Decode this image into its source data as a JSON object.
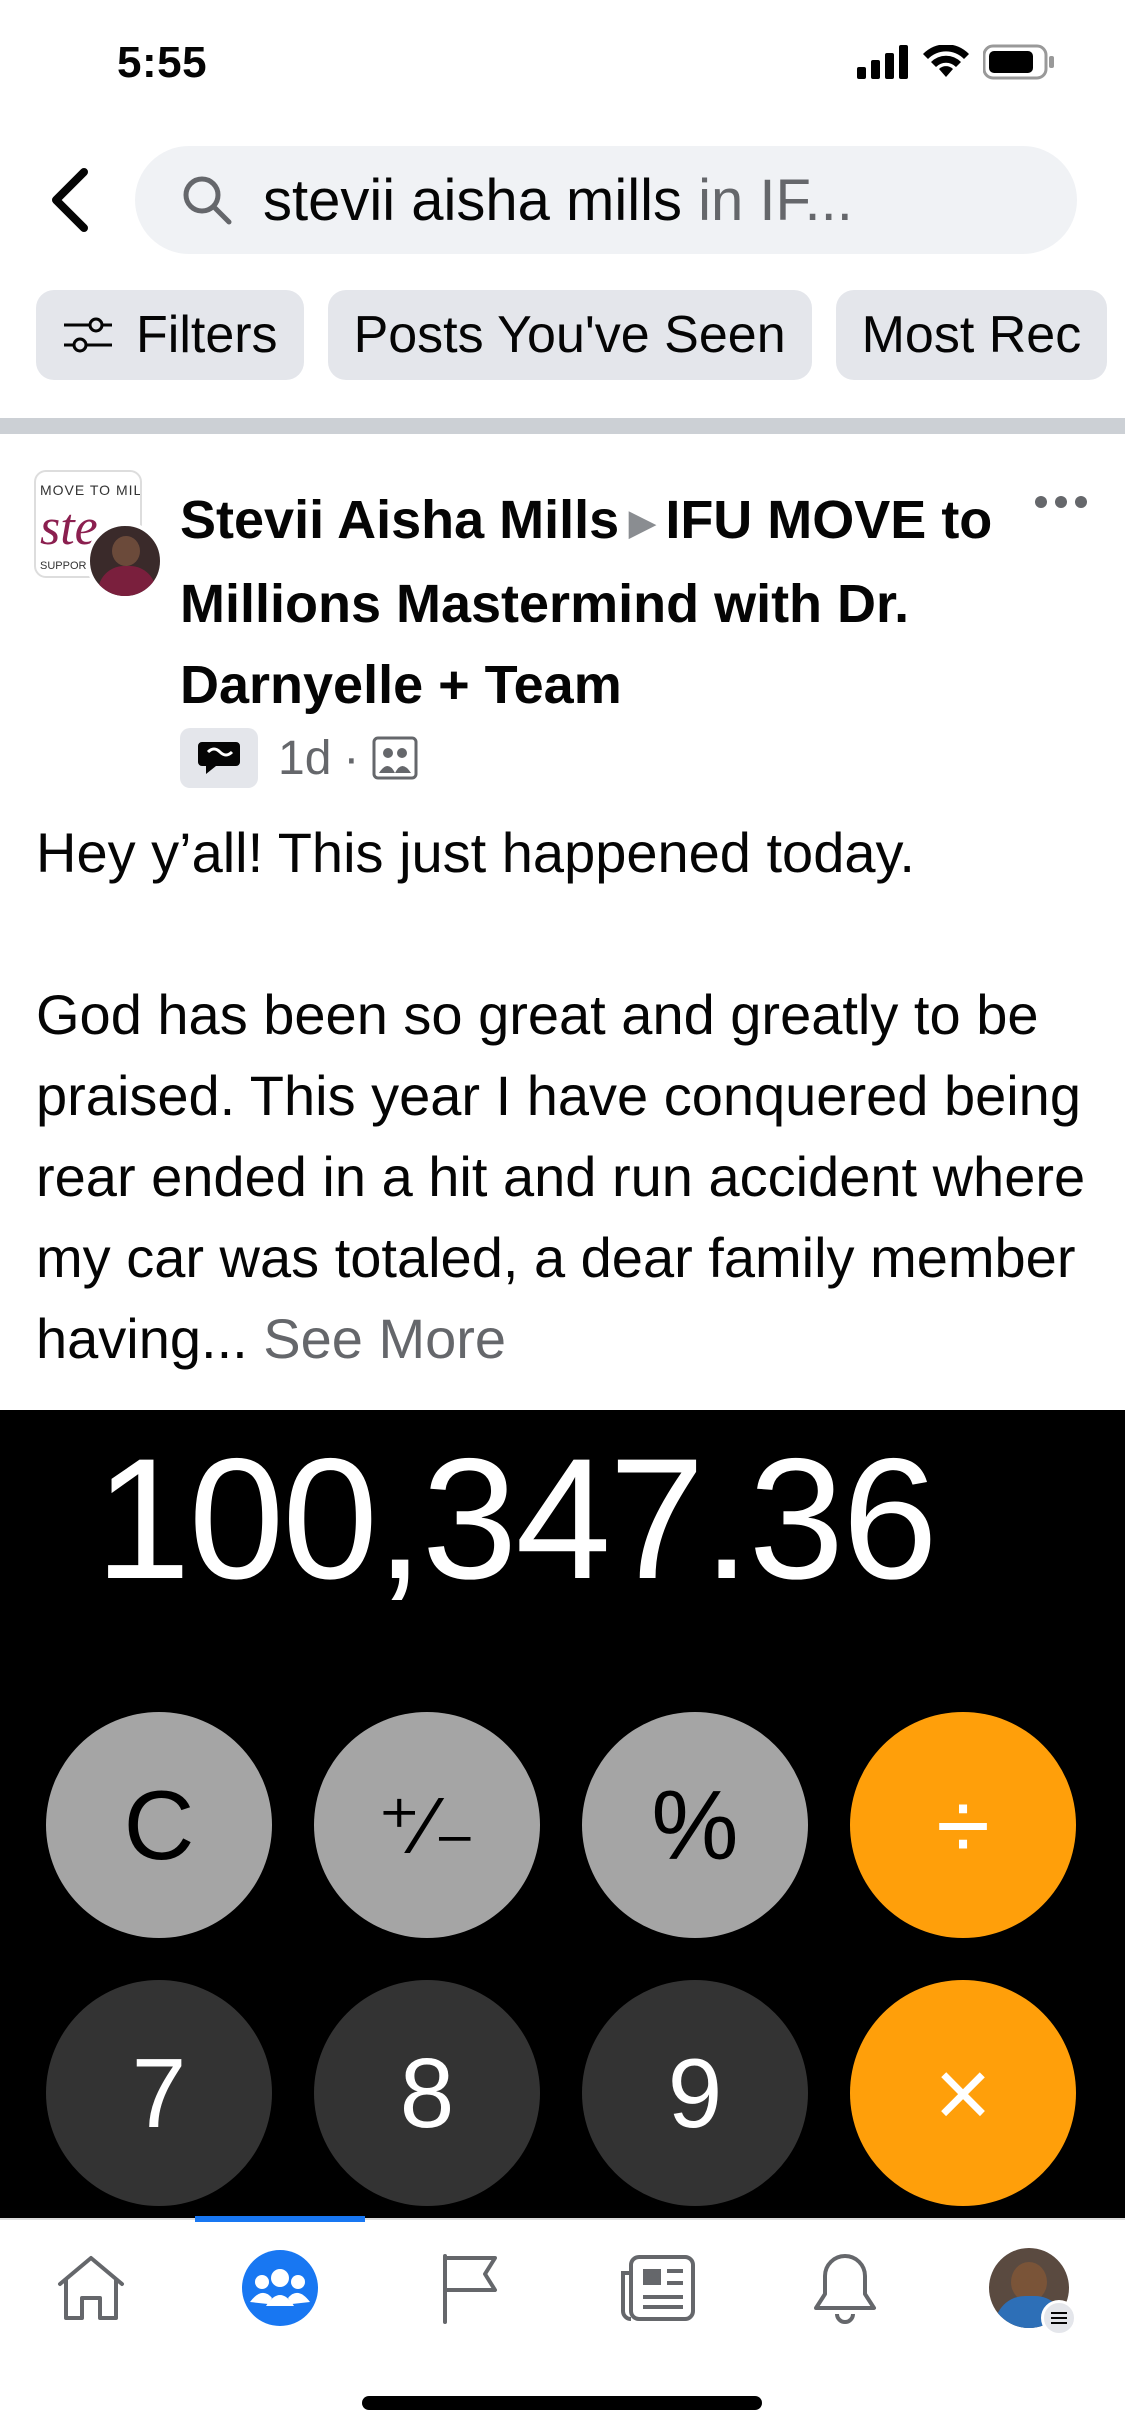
{
  "status": {
    "time": "5:55"
  },
  "search": {
    "query": "stevii aisha mills",
    "scope": " in IF..."
  },
  "chips": [
    {
      "label": "Filters"
    },
    {
      "label": "Posts You've Seen"
    },
    {
      "label": "Most Rec"
    }
  ],
  "post": {
    "author": "Stevii Aisha Mills",
    "group": "IFU MOVE to Millions Mastermind with Dr. Darnyelle + Team",
    "group_avatar_text": [
      "MOVE TO MIL",
      "ste",
      "SUPPORT"
    ],
    "time": "1d",
    "dot": "·",
    "body_line1": "Hey y’all! This just happened today.",
    "body_para2": "God has been so great and greatly to be praised. This year I have conquered being rear ended in a hit and run accident where my car was totaled, a dear family member having...",
    "see_more": "See More"
  },
  "calculator": {
    "display": "100,347.36",
    "keys": [
      "C",
      "⁺∕₋",
      "%",
      "÷",
      "7",
      "8",
      "9",
      "×"
    ]
  },
  "tabs": [
    {
      "name": "home-icon"
    },
    {
      "name": "groups-icon",
      "active": true
    },
    {
      "name": "pages-flag-icon"
    },
    {
      "name": "news-icon"
    },
    {
      "name": "notifications-bell-icon"
    },
    {
      "name": "profile-menu"
    }
  ],
  "colors": {
    "accent": "#1877f2",
    "orange": "#ff9f0a",
    "chip_bg": "#e4e6eb"
  }
}
